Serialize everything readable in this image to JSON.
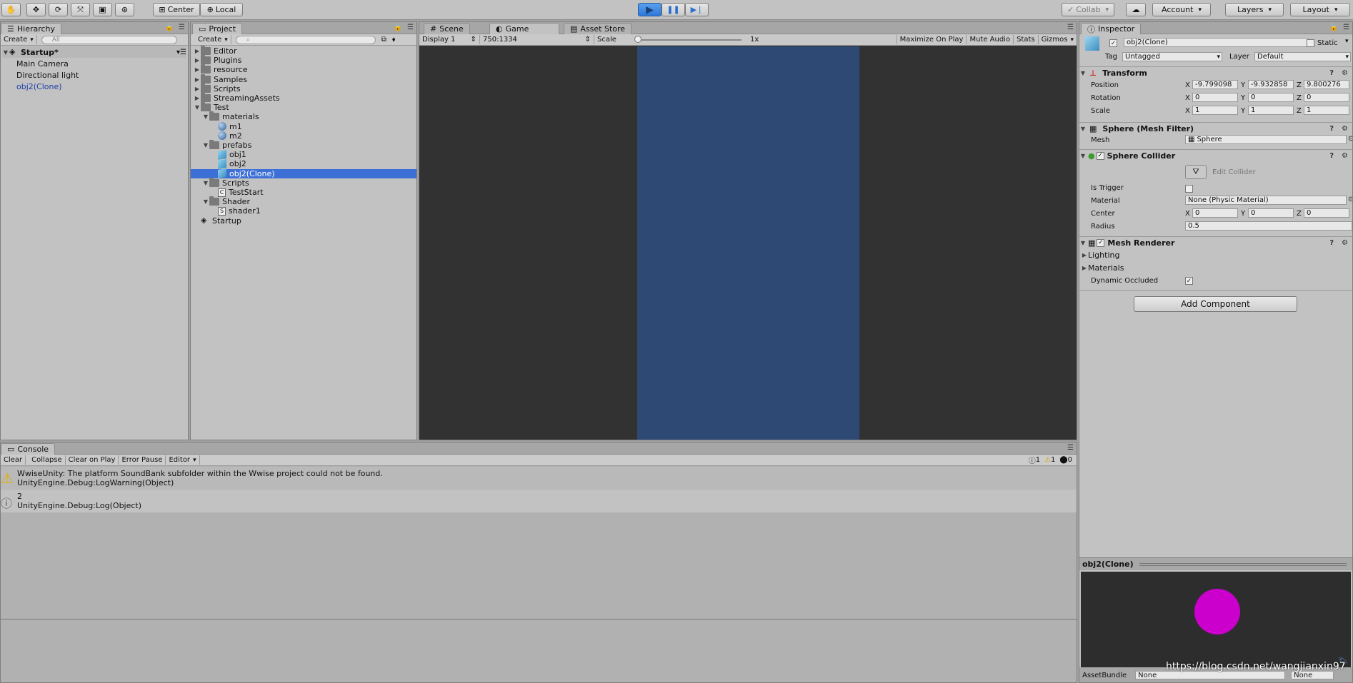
{
  "toolbar": {
    "pivot": "Center",
    "space": "Local",
    "collab": "Collab",
    "account": "Account",
    "layers": "Layers",
    "layout": "Layout"
  },
  "hierarchy": {
    "tab": "Hierarchy",
    "create": "Create",
    "search_placeholder": "All",
    "scene": "Startup*",
    "items": [
      "Main Camera",
      "Directional light",
      "obj2(Clone)"
    ]
  },
  "project": {
    "tab": "Project",
    "create": "Create",
    "tree": [
      {
        "label": "Editor",
        "kind": "folder",
        "depth": 0,
        "expanded": false
      },
      {
        "label": "Plugins",
        "kind": "folder",
        "depth": 0,
        "expanded": false
      },
      {
        "label": "resource",
        "kind": "folder",
        "depth": 0,
        "expanded": false
      },
      {
        "label": "Samples",
        "kind": "folder",
        "depth": 0,
        "expanded": false
      },
      {
        "label": "Scripts",
        "kind": "folder",
        "depth": 0,
        "expanded": false
      },
      {
        "label": "StreamingAssets",
        "kind": "folder",
        "depth": 0,
        "expanded": false
      },
      {
        "label": "Test",
        "kind": "folder",
        "depth": 0,
        "expanded": true
      },
      {
        "label": "materials",
        "kind": "folder",
        "depth": 1,
        "expanded": true
      },
      {
        "label": "m1",
        "kind": "material",
        "depth": 2
      },
      {
        "label": "m2",
        "kind": "material",
        "depth": 2
      },
      {
        "label": "prefabs",
        "kind": "folder",
        "depth": 1,
        "expanded": true
      },
      {
        "label": "obj1",
        "kind": "prefab",
        "depth": 2
      },
      {
        "label": "obj2",
        "kind": "prefab",
        "depth": 2
      },
      {
        "label": "obj2(Clone)",
        "kind": "prefab",
        "depth": 2,
        "selected": true
      },
      {
        "label": "Scripts",
        "kind": "folder",
        "depth": 1,
        "expanded": true
      },
      {
        "label": "TestStart",
        "kind": "csharp",
        "depth": 2
      },
      {
        "label": "Shader",
        "kind": "folder",
        "depth": 1,
        "expanded": true
      },
      {
        "label": "shader1",
        "kind": "shader",
        "depth": 2
      },
      {
        "label": "Startup",
        "kind": "scene",
        "depth": 0
      }
    ]
  },
  "game": {
    "tabs": [
      "Scene",
      "Game",
      "Asset Store"
    ],
    "display": "Display 1",
    "resolution": "750:1334",
    "scale_label": "Scale",
    "scale_value": "1x",
    "maximize": "Maximize On Play",
    "mute": "Mute Audio",
    "stats": "Stats",
    "gizmos": "Gizmos",
    "colors": {
      "background": "#323232",
      "viewport": "#2e4a74"
    }
  },
  "inspector": {
    "tab": "Inspector",
    "object_name": "obj2(Clone)",
    "static": "Static",
    "tag_label": "Tag",
    "tag": "Untagged",
    "layer_label": "Layer",
    "layer": "Default",
    "transform": {
      "title": "Transform",
      "position_label": "Position",
      "rotation_label": "Rotation",
      "scale_label": "Scale",
      "position": [
        "-9.799098",
        "-9.932858",
        "9.800276"
      ],
      "rotation": [
        "0",
        "0",
        "0"
      ],
      "scale": [
        "1",
        "1",
        "1"
      ]
    },
    "mesh_filter": {
      "title": "Sphere (Mesh Filter)",
      "mesh_label": "Mesh",
      "mesh": "Sphere"
    },
    "collider": {
      "title": "Sphere Collider",
      "edit": "Edit Collider",
      "trigger_label": "Is Trigger",
      "material_label": "Material",
      "material": "None (Physic Material)",
      "center_label": "Center",
      "center": [
        "0",
        "0",
        "0"
      ],
      "radius_label": "Radius",
      "radius": "0.5"
    },
    "renderer": {
      "title": "Mesh Renderer",
      "lighting": "Lighting",
      "materials": "Materials",
      "occluded": "Dynamic Occluded"
    },
    "add_component": "Add Component",
    "preview_title": "obj2(Clone)",
    "assetbundle": "AssetBundle",
    "assetbundle_value": "None",
    "variant_value": "None",
    "preview_color": "#cc00cc"
  },
  "console": {
    "tab": "Console",
    "buttons": [
      "Clear",
      "Collapse",
      "Clear on Play",
      "Error Pause",
      "Editor"
    ],
    "counts": [
      "1",
      "1",
      "0"
    ],
    "logs": [
      {
        "kind": "warning",
        "line1": "WwiseUnity: The platform SoundBank subfolder within the Wwise project could not be found.",
        "line2": "UnityEngine.Debug:LogWarning(Object)"
      },
      {
        "kind": "info",
        "line1": "2",
        "line2": "UnityEngine.Debug:Log(Object)"
      }
    ]
  },
  "watermark": "https://blog.csdn.net/wangjianxin97"
}
